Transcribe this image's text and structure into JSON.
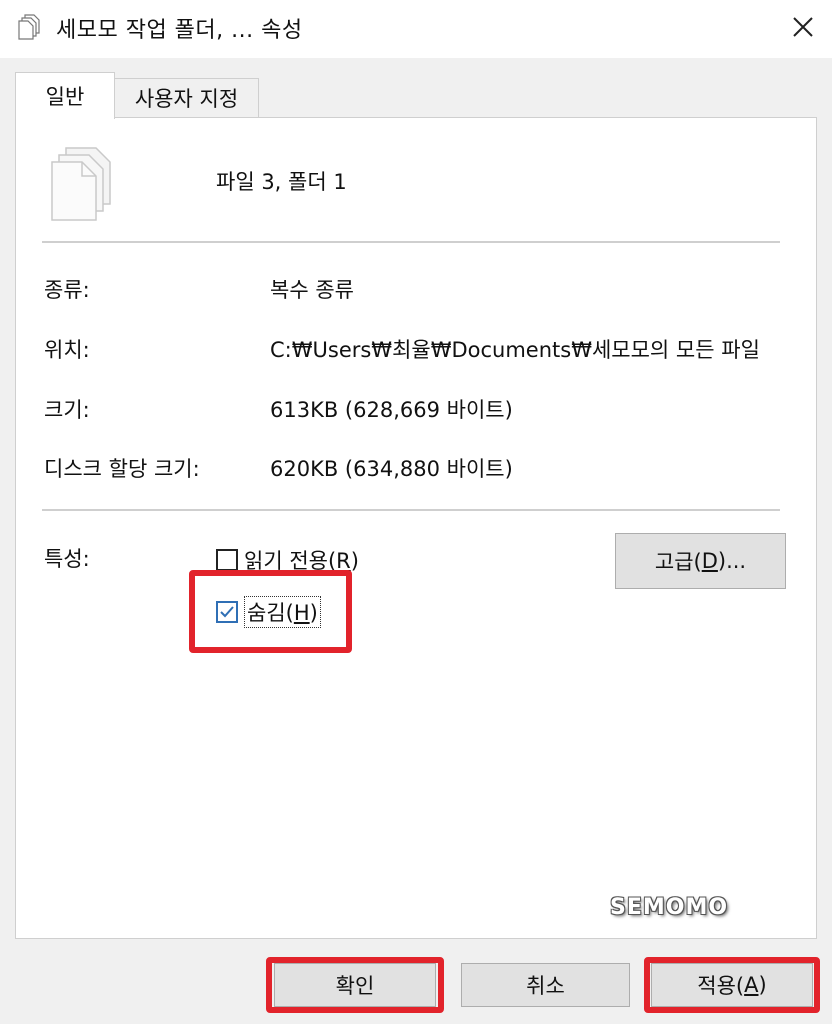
{
  "window": {
    "title": "세모모 작업 폴더, ... 속성",
    "close_glyph": "✕"
  },
  "tabs": [
    {
      "label": "일반",
      "active": true
    },
    {
      "label": "사용자 지정",
      "active": false
    }
  ],
  "general": {
    "summary": "파일 3, 폴더 1",
    "rows": [
      {
        "label": "종류:",
        "value": "복수 종류"
      },
      {
        "label": "위치:",
        "value": "C:₩Users₩최율₩Documents₩세모모의 모든 파일"
      },
      {
        "label": "크기:",
        "value": "613KB (628,669 바이트)"
      },
      {
        "label": "디스크 할당 크기:",
        "value": "620KB (634,880 바이트)"
      }
    ],
    "attributes": {
      "label": "특성:",
      "read_only": {
        "text": "읽기 전용(",
        "mnemonic": "R",
        "suffix": ")",
        "checked": false
      },
      "hidden": {
        "text": "숨김(",
        "mnemonic": "H",
        "suffix": ")",
        "checked": true
      },
      "advanced": {
        "text": "고급(",
        "mnemonic": "D",
        "suffix": ")..."
      }
    }
  },
  "watermark": "SEMOMO",
  "buttons": {
    "ok": "확인",
    "cancel": "취소",
    "apply": {
      "text": "적용(",
      "mnemonic": "A",
      "suffix": ")"
    }
  },
  "colors": {
    "highlight": "#e2232b",
    "checkbox_accent": "#2f6fb5",
    "button_bg": "#e1e1e1"
  }
}
